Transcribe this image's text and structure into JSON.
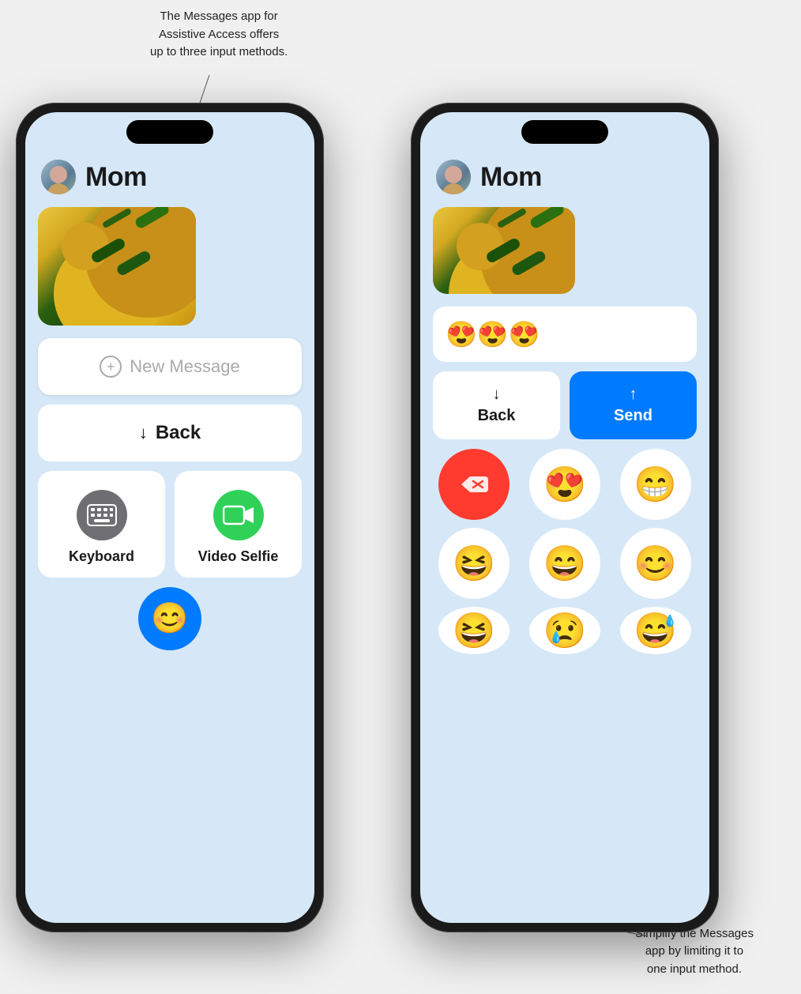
{
  "annotations": {
    "top": {
      "text": "The Messages app for\nAssistive Access offers\nup to three input methods.",
      "line1": "The Messages app for",
      "line2": "Assistive Access offers",
      "line3": "up to three input methods."
    },
    "bottom": {
      "text": "Simplify the Messages\napp by limiting it to\none input method.",
      "line1": "Simplify the Messages",
      "line2": "app by limiting it to",
      "line3": "one input method."
    }
  },
  "left_phone": {
    "contact_name": "Mom",
    "new_message_placeholder": "New Message",
    "back_label": "Back",
    "keyboard_label": "Keyboard",
    "video_selfie_label": "Video Selfie",
    "emoji_label": "Emoji"
  },
  "right_phone": {
    "contact_name": "Mom",
    "emoji_message": "😍😍😍",
    "back_label": "Back",
    "send_label": "Send",
    "emojis_row1": [
      "🗑",
      "😍",
      "😁"
    ],
    "emojis_row2": [
      "😆",
      "😄",
      "😊"
    ],
    "emojis_row3": [
      "😆",
      "😢",
      "😅"
    ],
    "delete_icon": "✕"
  }
}
